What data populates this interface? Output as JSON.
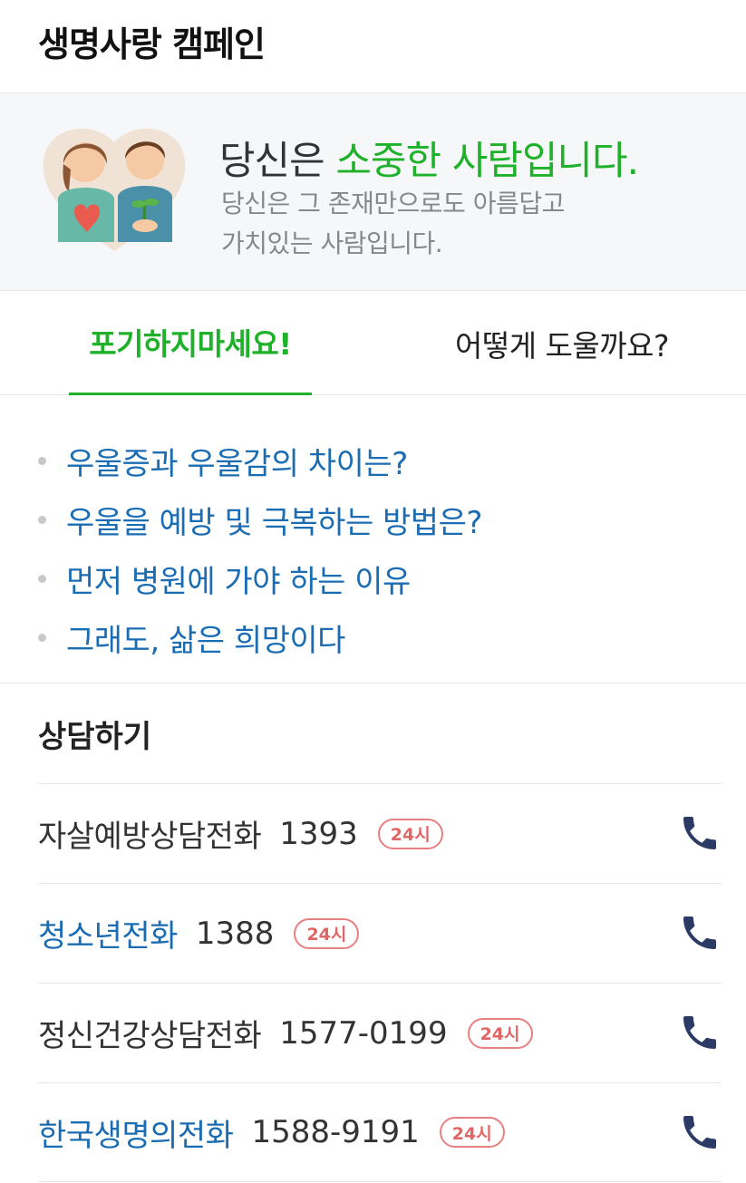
{
  "header": {
    "title": "생명사랑 캠페인"
  },
  "banner": {
    "headline_plain": "당신은 ",
    "headline_highlight": "소중한 사람입니다.",
    "subtitle_line1": "당신은 그 존재만으로도 아름답고",
    "subtitle_line2": "가치있는 사람입니다.",
    "illustration": "couple-holding-heart-and-plant"
  },
  "tabs": [
    {
      "label": "포기하지마세요!",
      "active": true
    },
    {
      "label": "어떻게 도울까요?",
      "active": false
    }
  ],
  "topics": [
    "우울증과 우울감의 차이는?",
    "우울을 예방 및 극복하는 방법은?",
    "먼저 병원에 가야 하는 이유",
    "그래도, 삶은 희망이다"
  ],
  "counsel": {
    "title": "상담하기",
    "lines": [
      {
        "name": "자살예방상담전화",
        "number": "1393",
        "badge": "24시",
        "link": false
      },
      {
        "name": "청소년전화",
        "number": "1388",
        "badge": "24시",
        "link": true
      },
      {
        "name": "정신건강상담전화",
        "number": "1577-0199",
        "badge": "24시",
        "link": false
      },
      {
        "name": "한국생명의전화",
        "number": "1588-9191",
        "badge": "24시",
        "link": true
      }
    ],
    "call_icon": "phone-icon"
  },
  "colors": {
    "accent_green": "#1eb129",
    "link_blue": "#1a6cb3",
    "badge_red": "#e06666",
    "phone_navy": "#2c3a66"
  }
}
